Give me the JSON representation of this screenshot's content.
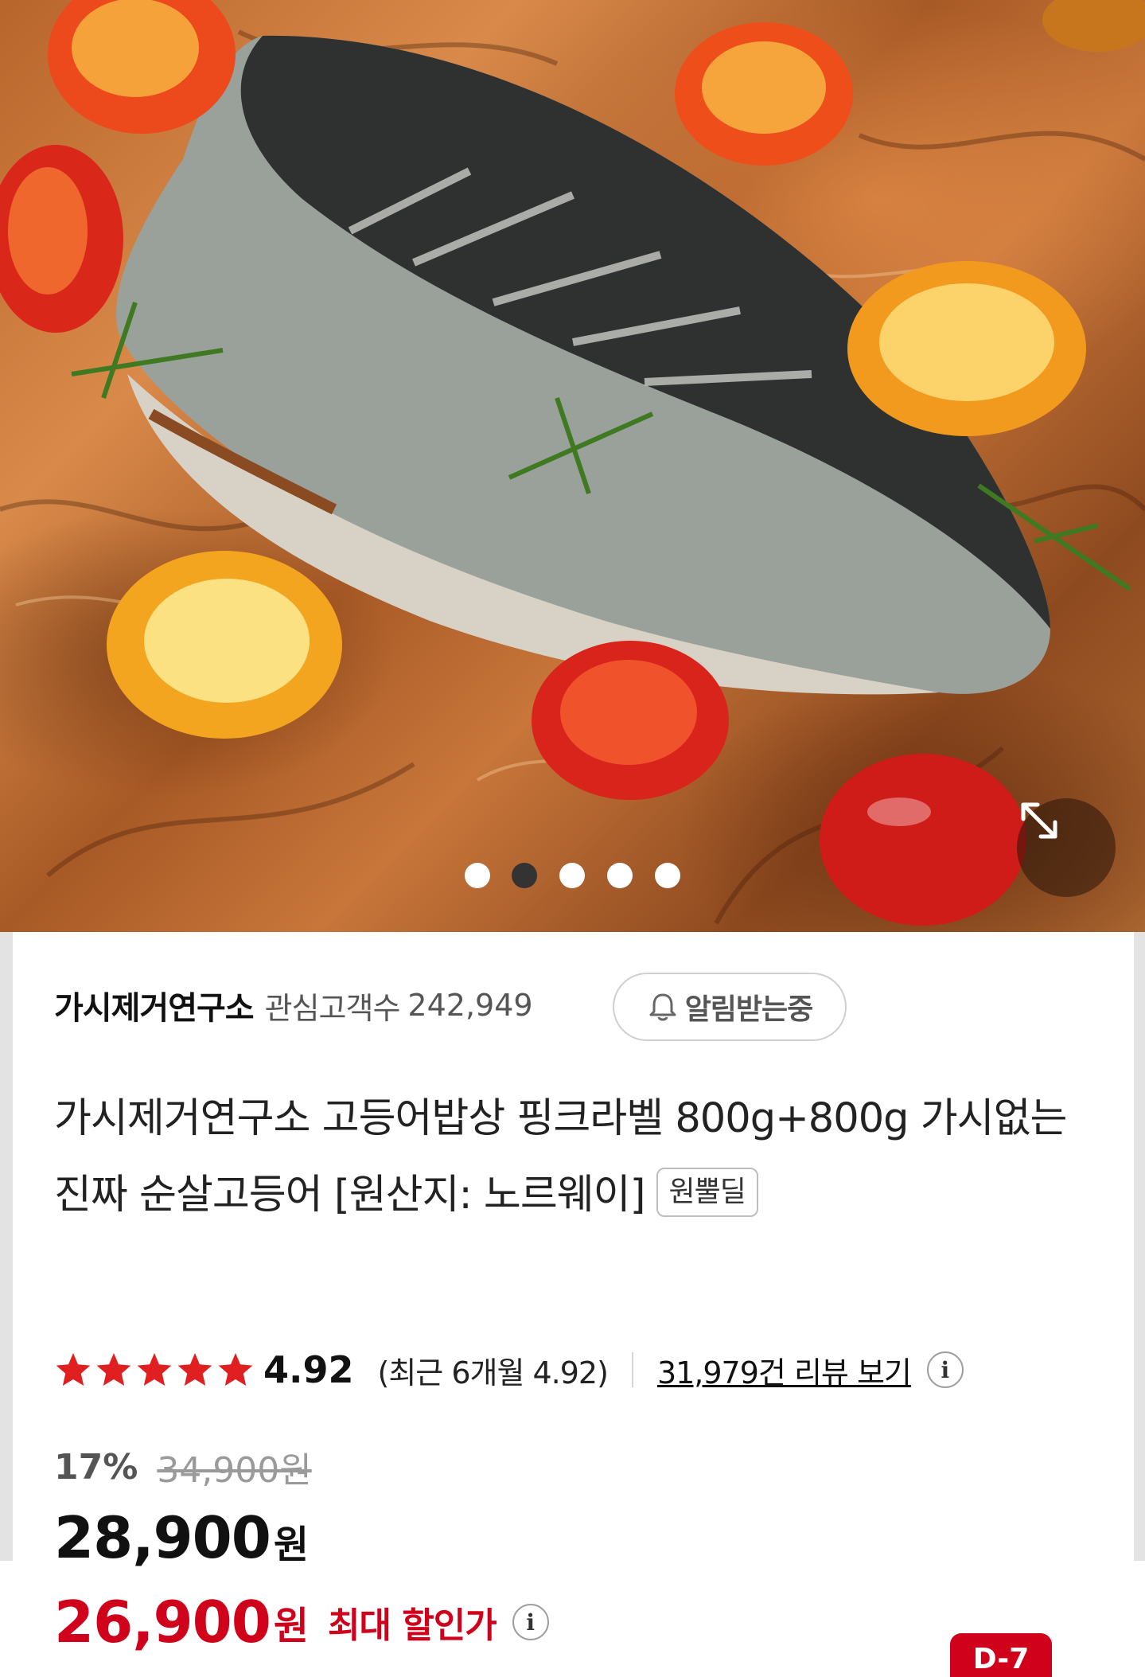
{
  "image_carousel": {
    "slide_count": 5,
    "active_index": 1
  },
  "seller": {
    "name": "가시제거연구소",
    "follower_label": "관심고객수",
    "follower_count": "242,949",
    "alarm_label": "알림받는중"
  },
  "product": {
    "title": "가시제거연구소 고등어밥상 핑크라벨 800g+800g 가시없는 진짜 순살고등어 [원산지: 노르웨이]",
    "badge": "원뿔딜"
  },
  "rating": {
    "stars": 5,
    "score": "4.92",
    "recent": "(최근 6개월 4.92)",
    "reviews_link": "31,979건 리뷰 보기",
    "info_icon": "i"
  },
  "price": {
    "discount_rate": "17%",
    "original": "34,900원",
    "sale": "28,900",
    "sale_unit": "원",
    "max_discount_price": "26,900",
    "max_discount_unit": "원",
    "max_discount_label": "최대 할인가",
    "info_icon": "i"
  },
  "dday_badge": "D-7",
  "colors": {
    "accent_red": "#d0021b",
    "star_red": "#e02020",
    "text_dark": "#111111",
    "text_gray": "#555555"
  },
  "icons": {
    "expand": "expand-arrows-icon",
    "bell": "bell-icon",
    "star": "star-icon",
    "info": "info-icon"
  }
}
